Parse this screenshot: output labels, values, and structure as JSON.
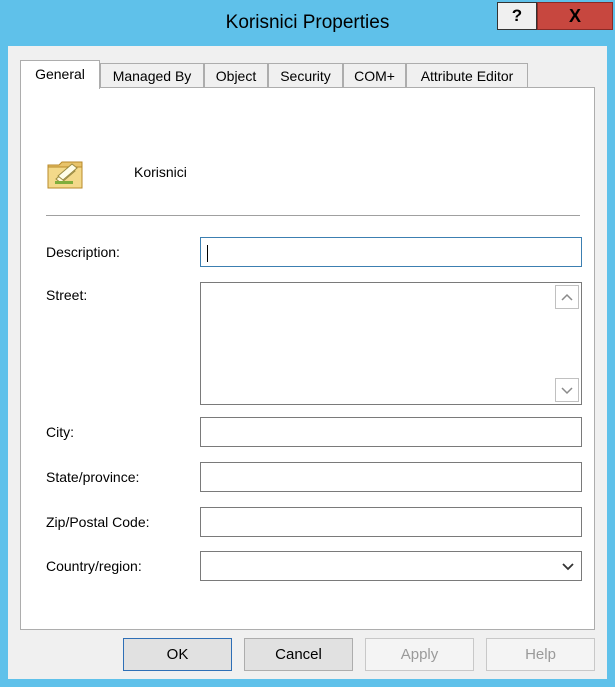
{
  "window": {
    "title": "Korisnici Properties",
    "help_label": "?",
    "close_label": "X"
  },
  "tabs": [
    {
      "label": "General",
      "active": true
    },
    {
      "label": "Managed By"
    },
    {
      "label": "Object"
    },
    {
      "label": "Security"
    },
    {
      "label": "COM+"
    },
    {
      "label": "Attribute Editor"
    }
  ],
  "general": {
    "icon": "organizational-unit-icon",
    "object_name": "Korisnici",
    "description_label": "Description:",
    "description_value": "",
    "street_label": "Street:",
    "street_value": "",
    "city_label": "City:",
    "city_value": "",
    "state_label": "State/province:",
    "state_value": "",
    "zip_label": "Zip/Postal Code:",
    "zip_value": "",
    "country_label": "Country/region:",
    "country_value": ""
  },
  "buttons": {
    "ok": "OK",
    "cancel": "Cancel",
    "apply": "Apply",
    "help": "Help"
  },
  "colors": {
    "frame": "#5fc1ea",
    "close": "#c7473f",
    "focus": "#3c7fb1"
  }
}
